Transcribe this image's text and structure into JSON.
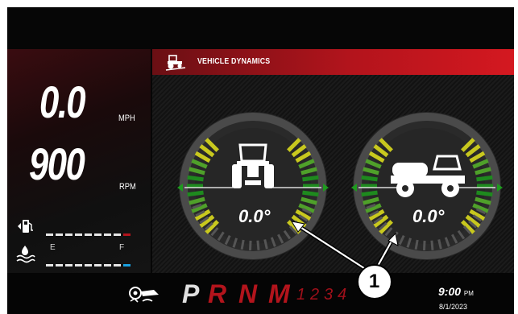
{
  "speed": {
    "value": "0.0",
    "unit": "MPH"
  },
  "engine": {
    "value": "900",
    "unit": "RPM"
  },
  "fuel": {
    "icon": "fuel-pump-icon",
    "level": 0.95,
    "low_color": "#b3141c"
  },
  "def": {
    "icon": "def-fluid-icon",
    "empty_label": "E",
    "full_label": "F",
    "level": 0.95,
    "high_color": "#19a0e0"
  },
  "vehicle_dynamics": {
    "icon": "tractor-leveling-icon",
    "title": "VEHICLE DYNAMICS",
    "pitch": {
      "icon": "tractor-front-view-icon",
      "value": "0.0°"
    },
    "roll": {
      "icon": "sprayer-side-view-icon",
      "value": "0.0°"
    }
  },
  "transmission": {
    "icon": "transmission-oil-icon",
    "gears": [
      "P",
      "R",
      "N",
      "M"
    ],
    "active_gear": "P",
    "ranges": [
      "1",
      "2",
      "3",
      "4"
    ]
  },
  "clock": {
    "time": "9:00",
    "ampm": "PM",
    "date": "8/1/2023"
  },
  "callout": {
    "label": "1"
  },
  "colors": {
    "accent": "#b3141c",
    "gauge_green": "#1e8a1e",
    "gauge_yellow": "#c8c81e"
  }
}
